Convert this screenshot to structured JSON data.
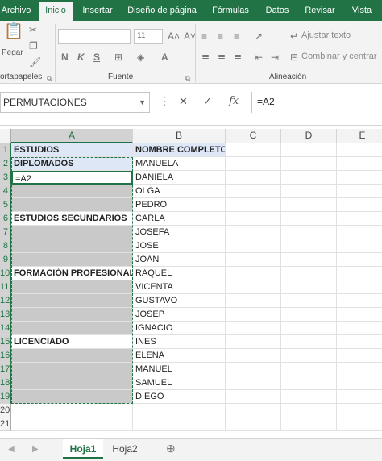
{
  "ribbon_tabs": [
    "Archivo",
    "Inicio",
    "Insertar",
    "Diseño de página",
    "Fórmulas",
    "Datos",
    "Revisar",
    "Vista"
  ],
  "active_tab": "Inicio",
  "ribbon": {
    "paste_label": "Pegar",
    "clipboard_group": "ortapapeles",
    "font_group": "Fuente",
    "alignment_group": "Alineación",
    "font_size": "11",
    "wrap_text": "Ajustar texto",
    "merge_center": "Combinar y centrar",
    "bold": "N",
    "italic": "K",
    "underline": "S"
  },
  "formula_bar": {
    "name_box": "PERMUTACIONES",
    "formula": "=A2",
    "cancel_icon": "✕",
    "enter_icon": "✓",
    "fx_label": "fx"
  },
  "columns": [
    "A",
    "B",
    "C",
    "D",
    "E"
  ],
  "selected_column": "A",
  "rows": [
    {
      "n": "1",
      "a": "ESTUDIOS",
      "b": "NOMBRE COMPLETO"
    },
    {
      "n": "2",
      "a": "DIPLOMADOS",
      "b": "MANUELA"
    },
    {
      "n": "3",
      "a": "=A2",
      "b": "DANIELA"
    },
    {
      "n": "4",
      "a": "",
      "b": "OLGA"
    },
    {
      "n": "5",
      "a": "",
      "b": "PEDRO"
    },
    {
      "n": "6",
      "a": "ESTUDIOS SECUNDARIOS",
      "b": "CARLA"
    },
    {
      "n": "7",
      "a": "",
      "b": "JOSEFA"
    },
    {
      "n": "8",
      "a": "",
      "b": "JOSE"
    },
    {
      "n": "9",
      "a": "",
      "b": "JOAN"
    },
    {
      "n": "10",
      "a": "FORMACIÓN PROFESIONAL",
      "b": "RAQUEL"
    },
    {
      "n": "11",
      "a": "",
      "b": "VICENTA"
    },
    {
      "n": "12",
      "a": "",
      "b": "GUSTAVO"
    },
    {
      "n": "13",
      "a": "",
      "b": "JOSEP"
    },
    {
      "n": "14",
      "a": "",
      "b": "IGNACIO"
    },
    {
      "n": "15",
      "a": "LICENCIADO",
      "b": "INES"
    },
    {
      "n": "16",
      "a": "",
      "b": "ELENA"
    },
    {
      "n": "17",
      "a": "",
      "b": "MANUEL"
    },
    {
      "n": "18",
      "a": "",
      "b": "SAMUEL"
    },
    {
      "n": "19",
      "a": "",
      "b": "DIEGO"
    },
    {
      "n": "20",
      "a": "",
      "b": ""
    },
    {
      "n": "21",
      "a": "",
      "b": ""
    }
  ],
  "sheet_tabs": [
    "Hoja1",
    "Hoja2"
  ],
  "active_sheet": "Hoja1",
  "colors": {
    "accent": "#217346",
    "gray_fill": "#c9c9c9",
    "header_fill": "#dde7f6"
  }
}
